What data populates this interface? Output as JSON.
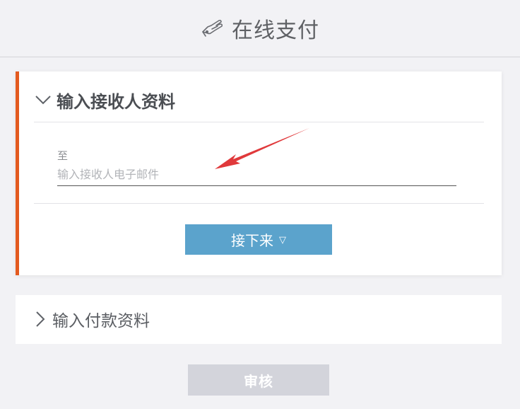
{
  "header": {
    "icon": "hand-payment-icon",
    "title": "在线支付"
  },
  "section_recipient": {
    "expanded": true,
    "chevron": "chevron-down-icon",
    "title": "输入接收人资料",
    "accent_color": "#e35a1f",
    "to_label": "至",
    "email": {
      "value": "",
      "placeholder": "输入接收人电子邮件"
    },
    "next_button": {
      "label": "接下来",
      "icon": "▽",
      "color": "#5ba3cc"
    }
  },
  "section_payment": {
    "expanded": false,
    "chevron": "chevron-right-icon",
    "title": "输入付款资料"
  },
  "review_button": {
    "label": "审核",
    "disabled": true
  }
}
